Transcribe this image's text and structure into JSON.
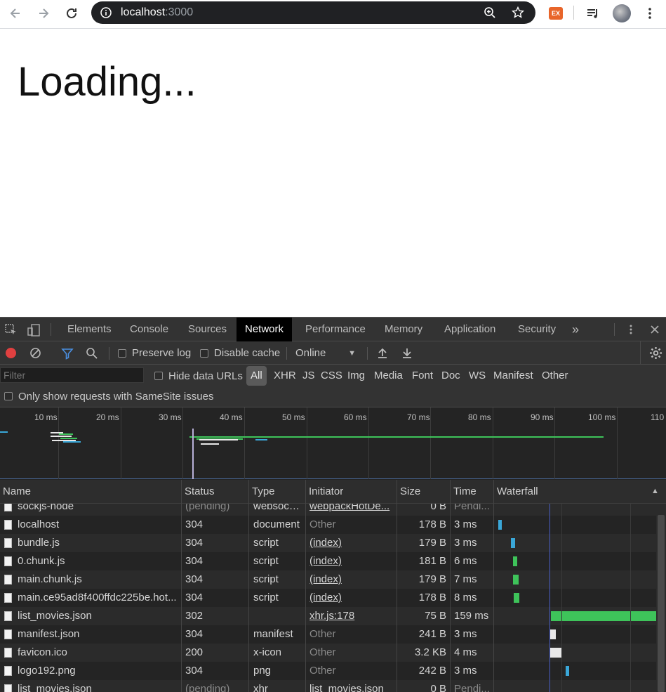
{
  "browser": {
    "url_host": "localhost",
    "url_port": ":3000",
    "ext_label": "EX"
  },
  "page": {
    "loading_text": "Loading..."
  },
  "devtools": {
    "tabs": [
      "Elements",
      "Console",
      "Sources",
      "Network",
      "Performance",
      "Memory",
      "Application",
      "Security"
    ],
    "active_tab": "Network",
    "more_tabs": "»",
    "toolbar": {
      "preserve_log": "Preserve log",
      "disable_cache": "Disable cache",
      "throttle": "Online"
    },
    "filter": {
      "placeholder": "Filter",
      "hide_data_urls": "Hide data URLs",
      "types": [
        "All",
        "XHR",
        "JS",
        "CSS",
        "Img",
        "Media",
        "Font",
        "Doc",
        "WS",
        "Manifest",
        "Other"
      ],
      "samesite": "Only show requests with SameSite issues"
    },
    "overview_ticks": [
      "10 ms",
      "20 ms",
      "30 ms",
      "40 ms",
      "50 ms",
      "60 ms",
      "70 ms",
      "80 ms",
      "90 ms",
      "100 ms",
      "110"
    ],
    "columns": [
      "Name",
      "Status",
      "Type",
      "Initiator",
      "Size",
      "Time",
      "Waterfall"
    ],
    "rows": [
      {
        "name": "sockjs-node",
        "status": "(pending)",
        "type": "websock...",
        "initiator": "webpackHotDe...",
        "size": "0 B",
        "time": "Pendi..."
      },
      {
        "name": "localhost",
        "status": "304",
        "type": "document",
        "initiator": "Other",
        "size": "178 B",
        "time": "3 ms"
      },
      {
        "name": "bundle.js",
        "status": "304",
        "type": "script",
        "initiator": "(index)",
        "size": "179 B",
        "time": "3 ms"
      },
      {
        "name": "0.chunk.js",
        "status": "304",
        "type": "script",
        "initiator": "(index)",
        "size": "181 B",
        "time": "6 ms"
      },
      {
        "name": "main.chunk.js",
        "status": "304",
        "type": "script",
        "initiator": "(index)",
        "size": "179 B",
        "time": "7 ms"
      },
      {
        "name": "main.ce95ad8f400ffdc225be.hot...",
        "status": "304",
        "type": "script",
        "initiator": "(index)",
        "size": "178 B",
        "time": "8 ms"
      },
      {
        "name": "list_movies.json",
        "status": "302",
        "type": "",
        "initiator": "xhr.js:178",
        "size": "75 B",
        "time": "159 ms"
      },
      {
        "name": "manifest.json",
        "status": "304",
        "type": "manifest",
        "initiator": "Other",
        "size": "241 B",
        "time": "3 ms"
      },
      {
        "name": "favicon.ico",
        "status": "200",
        "type": "x-icon",
        "initiator": "Other",
        "size": "3.2 KB",
        "time": "4 ms"
      },
      {
        "name": "logo192.png",
        "status": "304",
        "type": "png",
        "initiator": "Other",
        "size": "242 B",
        "time": "3 ms"
      },
      {
        "name": "list_movies.json",
        "status": "(pending)",
        "type": "xhr",
        "initiator": "list_movies.json",
        "size": "0 B",
        "time": "Pendi..."
      }
    ],
    "colors": {
      "record": "#e04040",
      "filter_active": "#4a90e2",
      "wf_green": "#3ec35a",
      "wf_blue": "#3aa7d8"
    }
  }
}
